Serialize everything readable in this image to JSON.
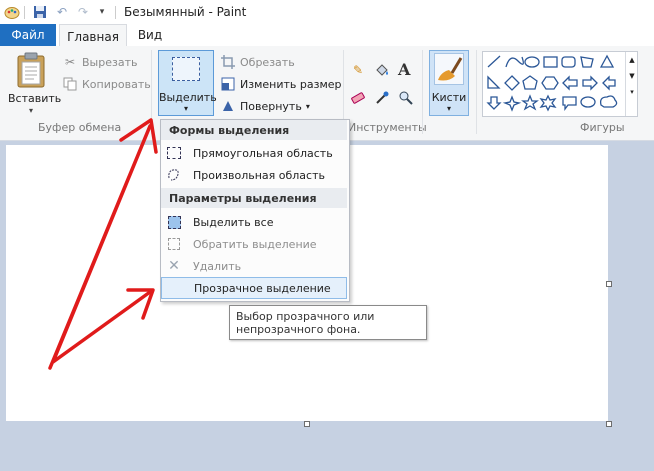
{
  "window": {
    "title": "Безымянный - Paint"
  },
  "tabs": {
    "file": "Файл",
    "home": "Главная",
    "view": "Вид"
  },
  "clipboard": {
    "paste": "Вставить",
    "cut": "Вырезать",
    "copy": "Копировать",
    "label": "Буфер обмена"
  },
  "image": {
    "select": "Выделить",
    "crop": "Обрезать",
    "resize": "Изменить размер",
    "rotate": "Повернуть"
  },
  "tools": {
    "label": "Инструменты"
  },
  "brushes": {
    "label": "Кисти"
  },
  "shapes": {
    "label": "Фигуры"
  },
  "menu": {
    "section_shapes": "Формы выделения",
    "rect": "Прямоугольная область",
    "free": "Произвольная область",
    "section_params": "Параметры выделения",
    "select_all": "Выделить все",
    "invert": "Обратить выделение",
    "delete": "Удалить",
    "transparent": "Прозрачное выделение"
  },
  "tooltip": {
    "line1": "Выбор прозрачного или",
    "line2": "непрозрачного фона."
  },
  "colors": {
    "file_tab": "#1f6fc1",
    "arrow": "#e01b1b"
  }
}
